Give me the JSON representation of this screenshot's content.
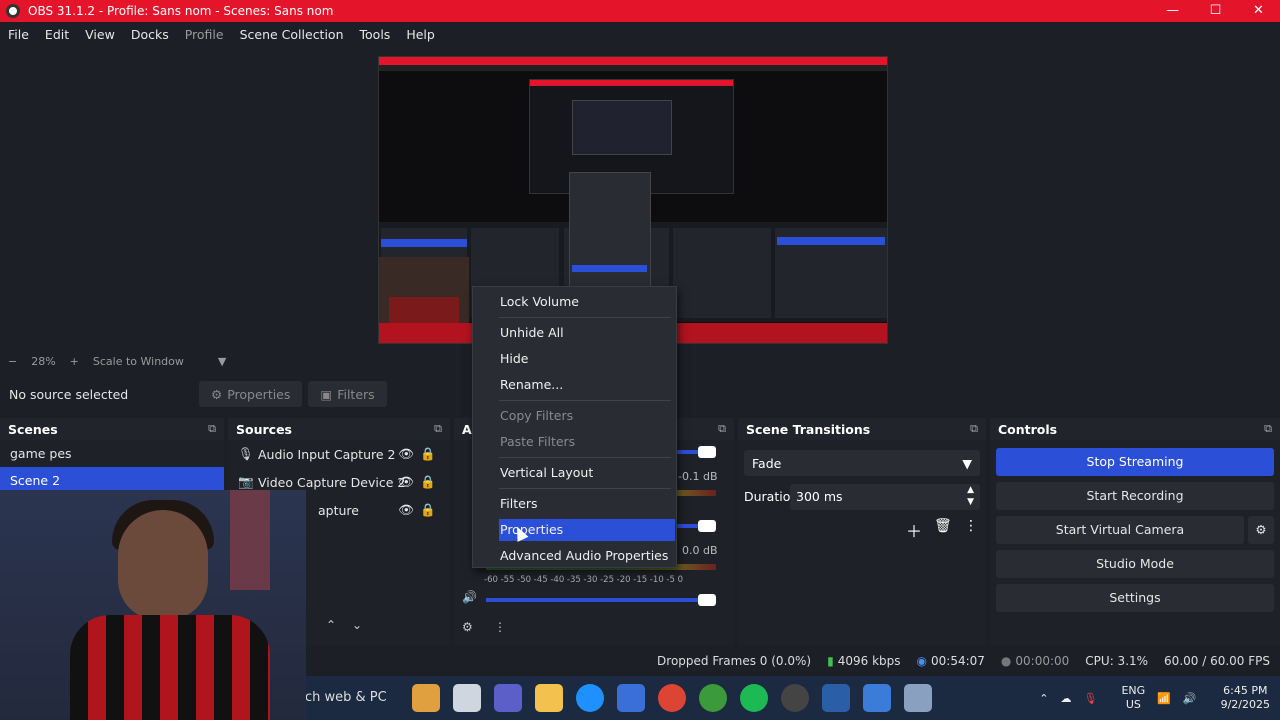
{
  "window": {
    "title": "OBS 31.1.2 - Profile: Sans nom - Scenes: Sans nom",
    "minimize": "—",
    "maximize": "☐",
    "close": "✕"
  },
  "menu": [
    "File",
    "Edit",
    "View",
    "Docks",
    "Profile",
    "Scene Collection",
    "Tools",
    "Help"
  ],
  "zoombar": {
    "minus": "−",
    "zoom": "28%",
    "plus": "+",
    "scale": "Scale to Window",
    "arrow": "▼"
  },
  "propbar": {
    "no_source": "No source selected",
    "properties": "Properties",
    "filters": "Filters"
  },
  "scenes": {
    "title": "Scenes",
    "items": [
      "game pes",
      "Scene 2"
    ]
  },
  "sources": {
    "title": "Sources",
    "items": [
      {
        "label": "Audio Input Capture 2",
        "icon": "🎙"
      },
      {
        "label": "Video Capture Device 2",
        "icon": "📷"
      },
      {
        "label": "apture",
        "icon": ""
      }
    ]
  },
  "audio": {
    "title": "A",
    "db1": "-0.1 dB",
    "db2": "0.0 dB",
    "scale": "-60 -55 -50 -45 -40 -35 -30 -25 -20 -15 -10 -5 0"
  },
  "transitions": {
    "title": "Scene Transitions",
    "selected": "Fade",
    "duration_label": "Duration",
    "duration_value": "300 ms"
  },
  "controls": {
    "title": "Controls",
    "buttons": [
      "Stop Streaming",
      "Start Recording",
      "Start Virtual Camera",
      "Studio Mode",
      "Settings"
    ]
  },
  "context_menu": {
    "items": [
      {
        "label": "Lock Volume",
        "disabled": false
      },
      {
        "label": "Unhide All",
        "disabled": false
      },
      {
        "label": "Hide",
        "disabled": false
      },
      {
        "label": "Rename...",
        "disabled": false
      },
      {
        "label": "Copy Filters",
        "disabled": true
      },
      {
        "label": "Paste Filters",
        "disabled": true
      },
      {
        "label": "Vertical Layout",
        "disabled": false
      },
      {
        "label": "Filters",
        "disabled": false
      },
      {
        "label": "Properties",
        "disabled": false,
        "highlighted": true
      },
      {
        "label": "Advanced Audio Properties",
        "disabled": false
      }
    ]
  },
  "status": {
    "dropped": "Dropped Frames 0 (0.0%)",
    "bitrate": "4096 kbps",
    "stream_time": "00:54:07",
    "rec_time": "00:00:00",
    "cpu": "CPU: 3.1%",
    "fps": "60.00 / 60.00 FPS"
  },
  "taskbar": {
    "search": "ch web & PC",
    "lang": "ENG",
    "region": "US",
    "time": "6:45 PM",
    "date": "9/2/2025"
  }
}
